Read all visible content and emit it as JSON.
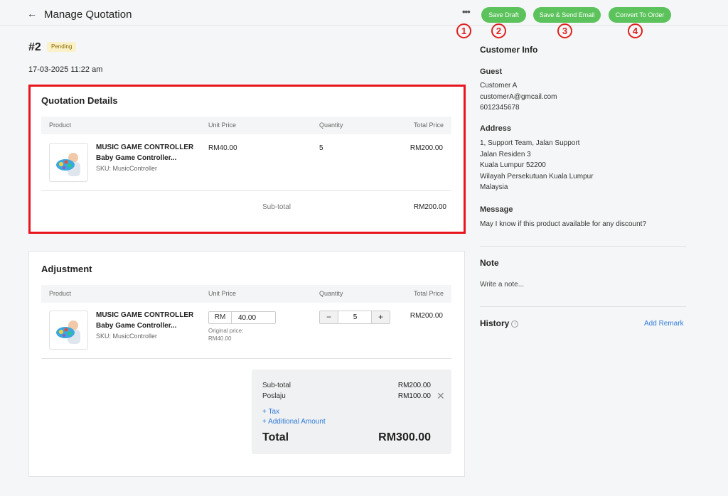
{
  "header": {
    "title": "Manage Quotation",
    "more_label": "•••",
    "save_draft": "Save Draft",
    "save_send": "Save & Send Email",
    "convert": "Convert To Order"
  },
  "markers": [
    "1",
    "2",
    "3",
    "4"
  ],
  "quotation": {
    "number": "#2",
    "status": "Pending",
    "date": "17-03-2025 11:22 am"
  },
  "details": {
    "title": "Quotation Details",
    "columns": [
      "Product",
      "Unit Price",
      "Quantity",
      "Total Price"
    ],
    "item": {
      "name_line1": "MUSIC GAME CONTROLLER",
      "name_line2": "Baby Game Controller...",
      "sku": "SKU: MusicController",
      "unit_price": "RM40.00",
      "quantity": "5",
      "total": "RM200.00"
    },
    "subtotal_label": "Sub-total",
    "subtotal_value": "RM200.00"
  },
  "adjustment": {
    "title": "Adjustment",
    "columns": [
      "Product",
      "Unit Price",
      "Quantity",
      "Total Price"
    ],
    "item": {
      "name_line1": "MUSIC GAME CONTROLLER",
      "name_line2": "Baby Game Controller...",
      "sku": "SKU: MusicController",
      "currency": "RM",
      "price_value": "40.00",
      "original_label": "Original price:",
      "original_value": "RM40.00",
      "minus": "−",
      "quantity": "5",
      "plus": "+",
      "total": "RM200.00"
    },
    "summary": {
      "subtotal_label": "Sub-total",
      "subtotal_value": "RM200.00",
      "shipping_label": "Poslaju",
      "shipping_value": "RM100.00",
      "tax_link": "+ Tax",
      "additional_link": "+ Additional Amount",
      "total_label": "Total",
      "total_value": "RM300.00"
    }
  },
  "customer": {
    "heading": "Customer Info",
    "type": "Guest",
    "name": "Customer A",
    "email": "customerA@gmcail.com",
    "phone": "6012345678",
    "address_heading": "Address",
    "address_lines": [
      "1, Support Team, Jalan Support",
      "Jalan Residen 3",
      "Kuala Lumpur 52200",
      "Wilayah Persekutuan Kuala Lumpur",
      "Malaysia"
    ],
    "message_heading": "Message",
    "message": "May I know if this product available for any discount?"
  },
  "note": {
    "heading": "Note",
    "placeholder": "Write a note..."
  },
  "history": {
    "heading": "History",
    "add_remark": "Add Remark"
  },
  "colors": {
    "accent_green": "#5cc35c",
    "highlight_red": "#e8141e",
    "link_blue": "#2f7ad9",
    "badge_yellow": "#fbf1c8"
  }
}
